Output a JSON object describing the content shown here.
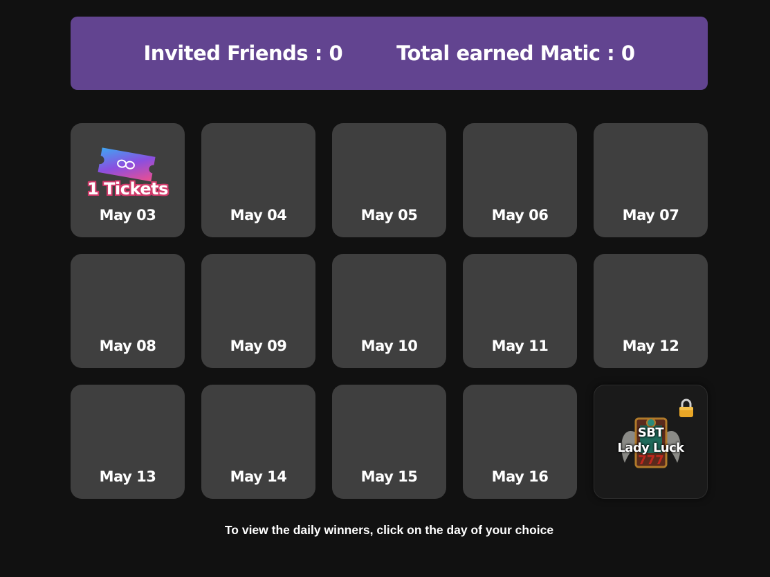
{
  "stats": {
    "invited_friends": "Invited Friends : 0",
    "total_earned": "Total earned Matic : 0"
  },
  "days": [
    {
      "label": "May 03",
      "reward": "1 Tickets"
    },
    {
      "label": "May 04"
    },
    {
      "label": "May 05"
    },
    {
      "label": "May 06"
    },
    {
      "label": "May 07"
    },
    {
      "label": "May 08"
    },
    {
      "label": "May 09"
    },
    {
      "label": "May 10"
    },
    {
      "label": "May 11"
    },
    {
      "label": "May 12"
    },
    {
      "label": "May 13"
    },
    {
      "label": "May 14"
    },
    {
      "label": "May 15"
    },
    {
      "label": "May 16"
    }
  ],
  "special_reward": {
    "line1": "SBT",
    "line2": "Lady Luck",
    "icon": "lady-luck-nft-icon",
    "status_icon": "lock-icon"
  },
  "hint": "To view the daily winners, click on the day of your choice",
  "colors": {
    "background": "#111111",
    "stats_bar": "#624490",
    "tile": "#3f3f3f",
    "ticket_outline": "#d13a6a"
  }
}
